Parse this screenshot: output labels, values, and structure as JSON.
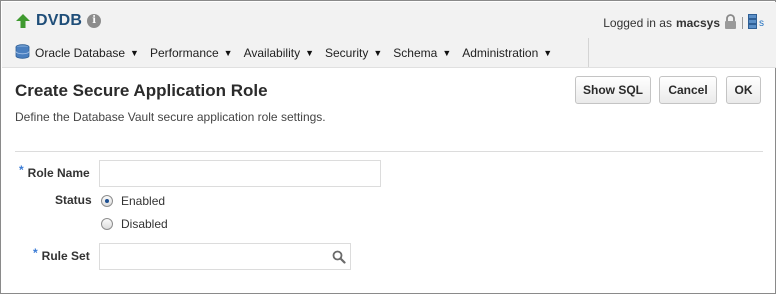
{
  "header": {
    "target_name": "DVDB",
    "logged_in_label": "Logged in as",
    "username": "macsys",
    "more_link": "s"
  },
  "menu": [
    {
      "label": "Oracle Database"
    },
    {
      "label": "Performance"
    },
    {
      "label": "Availability"
    },
    {
      "label": "Security"
    },
    {
      "label": "Schema"
    },
    {
      "label": "Administration"
    }
  ],
  "page": {
    "title": "Create Secure Application Role",
    "description": "Define the Database Vault secure application role settings."
  },
  "buttons": {
    "show_sql": "Show SQL",
    "cancel": "Cancel",
    "ok": "OK"
  },
  "form": {
    "required_marker": "*",
    "role_name_label": "Role Name",
    "role_name_value": "",
    "status_label": "Status",
    "status_options": [
      {
        "label": "Enabled",
        "selected": true
      },
      {
        "label": "Disabled",
        "selected": false
      }
    ],
    "rule_set_label": "Rule Set",
    "rule_set_value": ""
  },
  "colors": {
    "target_name": "#1f4e79",
    "up_arrow": "#3f9a2f",
    "required_marker": "#3a7bd5",
    "header_bg": "#f2f2f2"
  },
  "icons": [
    "up-arrow-icon",
    "info-icon",
    "lock-icon",
    "server-icon",
    "database-icon",
    "chevron-down-icon",
    "search-icon"
  ]
}
